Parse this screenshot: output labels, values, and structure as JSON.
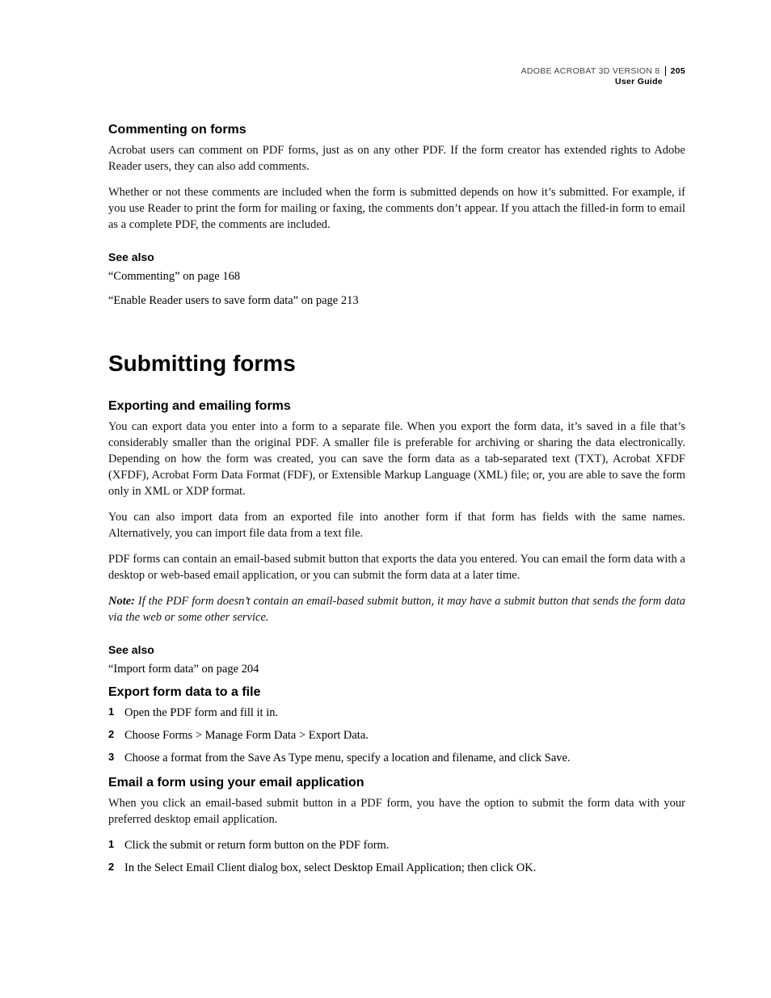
{
  "header": {
    "product": "ADOBE ACROBAT 3D VERSION 8",
    "page_number": "205",
    "subtitle": "User Guide"
  },
  "sections": {
    "commenting": {
      "title": "Commenting on forms",
      "p1": "Acrobat users can comment on PDF forms, just as on any other PDF. If the form creator has extended rights to Adobe Reader users, they can also add comments.",
      "p2": "Whether or not these comments are included when the form is submitted depends on how it’s submitted. For example, if you use Reader to print the form for mailing or faxing, the comments don’t appear. If you attach the filled-in form to email as a complete PDF, the comments are included.",
      "see_also_label": "See also",
      "refs": [
        "“Commenting” on page 168",
        "“Enable Reader users to save form data” on page 213"
      ]
    },
    "submitting_title": "Submitting forms",
    "exporting": {
      "title": "Exporting and emailing forms",
      "p1": "You can export data you enter into a form to a separate file. When you export the form data, it’s saved in a file that’s considerably smaller than the original PDF. A smaller file is preferable for archiving or sharing the data electronically. Depending on how the form was created, you can save the form data as a tab-separated text (TXT), Acrobat XFDF (XFDF), Acrobat Form Data Format (FDF), or Extensible Markup Language (XML) file; or, you are able to save the form only in XML or XDP format.",
      "p2": "You can also import data from an exported file into another form if that form has fields with the same names. Alternatively, you can import file data from a text file.",
      "p3": "PDF forms can contain an email-based submit button that exports the data you entered. You can email the form data with a desktop or web-based email application, or you can submit the form data at a later time.",
      "note_label": "Note:",
      "note_body": " If the PDF form doesn’t contain an email-based submit button, it may have a submit button that sends the form data via the web or some other service.",
      "see_also_label": "See also",
      "refs": [
        "“Import form data” on page 204"
      ]
    },
    "export_file": {
      "title": "Export form data to a file",
      "steps": [
        "Open the PDF form and fill it in.",
        "Choose Forms > Manage Form Data > Export Data.",
        "Choose a format from the Save As Type menu, specify a location and filename, and click Save."
      ]
    },
    "email_form": {
      "title": "Email a form using your email application",
      "p1": "When you click an email-based submit button in a PDF form, you have the option to submit the form data with your preferred desktop email application.",
      "steps": [
        "Click the submit or return form button on the PDF form.",
        "In the Select Email Client dialog box, select Desktop Email Application; then click OK."
      ]
    }
  }
}
